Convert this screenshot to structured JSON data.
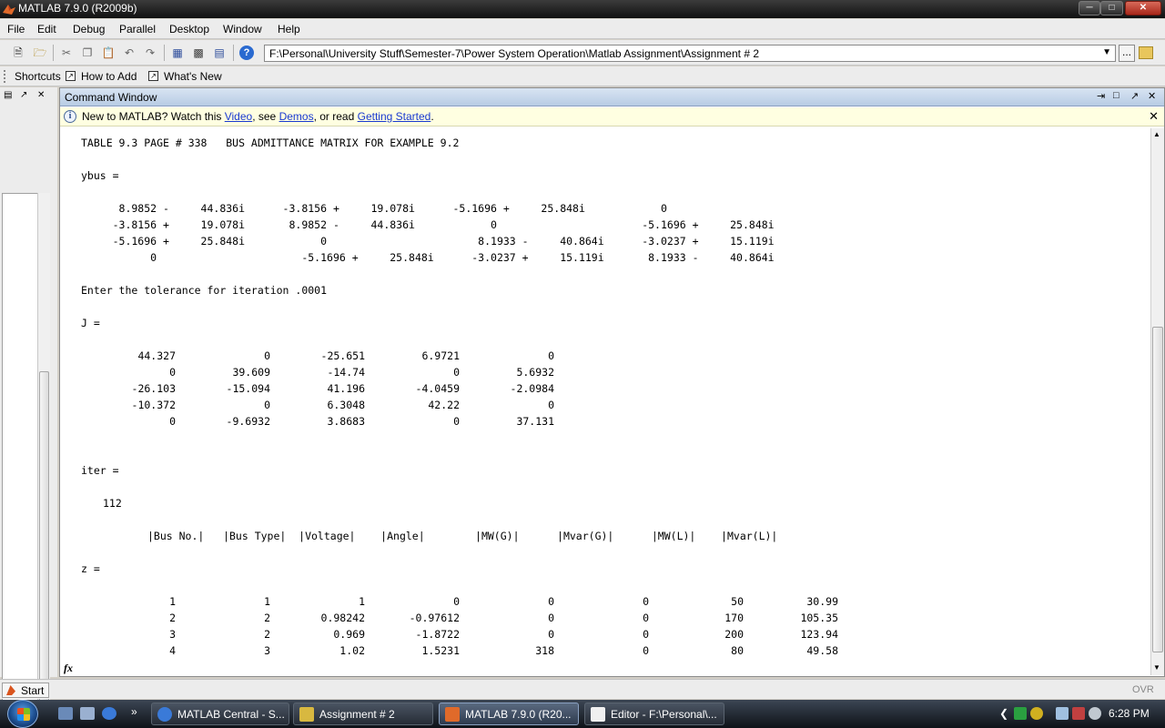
{
  "window": {
    "title": "MATLAB  7.9.0 (R2009b)"
  },
  "menu": [
    "File",
    "Edit",
    "Debug",
    "Parallel",
    "Desktop",
    "Window",
    "Help"
  ],
  "toolbar": {
    "current_directory": "F:\\Personal\\University Stuff\\Semester-7\\Power System Operation\\Matlab Assignment\\Assignment # 2",
    "browse_label": "..."
  },
  "shortcuts": {
    "label": "Shortcuts",
    "how_to_add": "How to Add",
    "whats_new": "What's New"
  },
  "command_window": {
    "title": "Command Window",
    "info": {
      "prefix": "New to MATLAB? Watch this ",
      "video_link": "Video",
      "mid1": ", see ",
      "demos_link": "Demos",
      "mid2": ", or read ",
      "getting_started_link": "Getting Started",
      "suffix": "."
    },
    "fx": "fx",
    "table_heading": "TABLE 9.3 PAGE # 338   BUS ADMITTANCE MATRIX FOR EXAMPLE 9.2",
    "ybus_label": "ybus =",
    "ybus_rows": [
      "      8.9852 -     44.836i      -3.8156 +     19.078i      -5.1696 +     25.848i            0",
      "     -3.8156 +     19.078i       8.9852 -     44.836i            0                       -5.1696 +     25.848i",
      "     -5.1696 +     25.848i            0                        8.1933 -     40.864i      -3.0237 +     15.119i",
      "           0                       -5.1696 +     25.848i      -3.0237 +     15.119i       8.1933 -     40.864i"
    ],
    "tolerance_prompt": "Enter the tolerance for iteration .0001",
    "j_label": "J =",
    "j_rows": [
      [
        "44.327",
        "0",
        "-25.651",
        "6.9721",
        "0"
      ],
      [
        "0",
        "39.609",
        "-14.74",
        "0",
        "5.6932"
      ],
      [
        "-26.103",
        "-15.094",
        "41.196",
        "-4.0459",
        "-2.0984"
      ],
      [
        "-10.372",
        "0",
        "6.3048",
        "42.22",
        "0"
      ],
      [
        "0",
        "-9.6932",
        "3.8683",
        "0",
        "37.131"
      ]
    ],
    "iter_label": "iter =",
    "iter_value": "112",
    "z_header": "|Bus No.|   |Bus Type|  |Voltage|    |Angle|        |MW(G)|      |Mvar(G)|      |MW(L)|    |Mvar(L)|",
    "z_label": "z =",
    "z_rows": [
      [
        "1",
        "1",
        "1",
        "0",
        "0",
        "0",
        "50",
        "30.99"
      ],
      [
        "2",
        "2",
        "0.98242",
        "-0.97612",
        "0",
        "0",
        "170",
        "105.35"
      ],
      [
        "3",
        "2",
        "0.969",
        "-1.8722",
        "0",
        "0",
        "200",
        "123.94"
      ],
      [
        "4",
        "3",
        "1.02",
        "1.5231",
        "318",
        "0",
        "80",
        "49.58"
      ]
    ]
  },
  "statusbar": {
    "start": "Start",
    "ovr": "OVR"
  },
  "taskbar": {
    "tasks": [
      "MATLAB Central - S...",
      "Assignment # 2",
      "MATLAB  7.9.0 (R20...",
      "Editor - F:\\Personal\\..."
    ],
    "clock": "6:28 PM"
  },
  "colors": {
    "link": "#1a3ad0",
    "info_bg": "#ffffe1",
    "titlebar": "#1a1a1a",
    "taskbar": "#1e2430"
  }
}
